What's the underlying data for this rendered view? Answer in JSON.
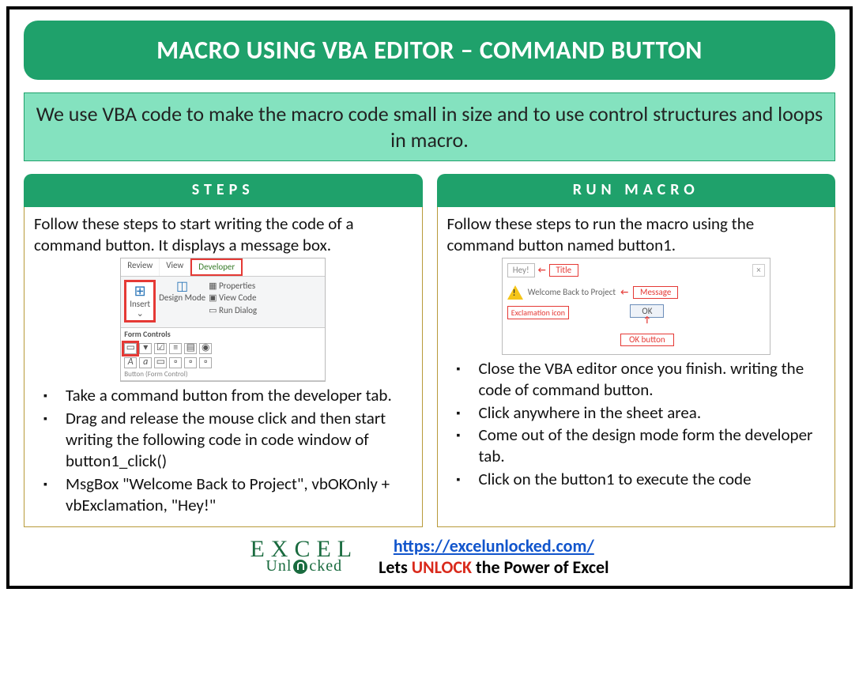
{
  "title": "MACRO USING VBA EDITOR – COMMAND BUTTON",
  "subtitle": "We use VBA code to make the macro code small in size and to use control structures and loops in macro.",
  "left": {
    "header": "STEPS",
    "intro": "Follow these steps to start writing the code of a command button. It displays a message box.",
    "ribbon": {
      "tabs": [
        "Review",
        "View",
        "Developer"
      ],
      "insert_label": "Insert",
      "design_label": "Design Mode",
      "properties": "Properties",
      "viewcode": "View Code",
      "rundialog": "Run Dialog",
      "form_controls_title": "Form Controls",
      "caption": "Button (Form Control)"
    },
    "bullets": [
      "Take a command button from the developer tab.",
      "Drag and release the mouse click and then start writing the following code in code window of button1_click()",
      "MsgBox \"Welcome Back to Project\", vbOKOnly + vbExclamation, \"Hey!\""
    ]
  },
  "right": {
    "header": "RUN MACRO",
    "intro": "Follow these steps to run the macro using the command button named button1.",
    "msgbox": {
      "hey": "Hey!",
      "title_label": "Title",
      "close": "×",
      "message_text": "Welcome Back to Project",
      "message_label": "Message",
      "excl_label": "Exclamation icon",
      "ok_text": "OK",
      "ok_label": "OK button"
    },
    "bullets": [
      "Close the VBA editor once you finish. writing the code of command button.",
      "Click anywhere in the sheet area.",
      "Come out of the design mode form the developer tab.",
      "Click on the button1 to execute the code"
    ]
  },
  "footer": {
    "logo_top": "EXCEL",
    "logo_bottom_pre": "Unl",
    "logo_bottom_post": "cked",
    "url": "https://excelunlocked.com/",
    "tag_pre": "Lets ",
    "tag_unlock": "UNLOCK",
    "tag_post": " the Power of Excel"
  }
}
